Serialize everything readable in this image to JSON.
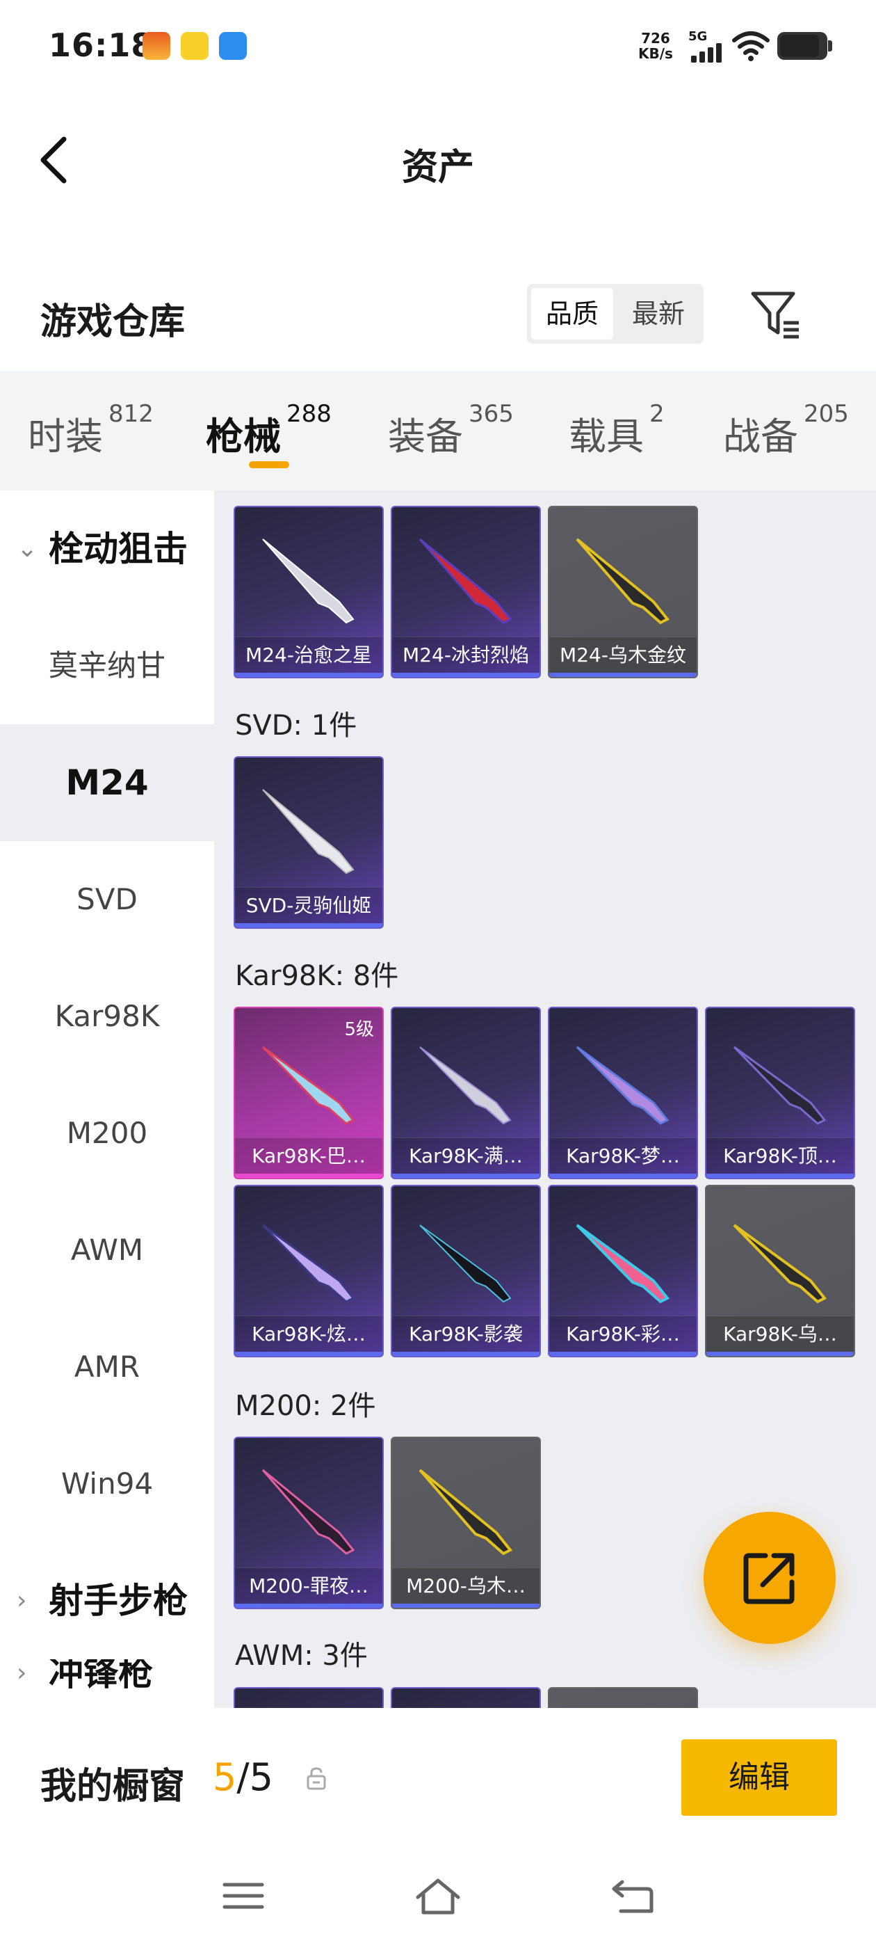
{
  "status_bar": {
    "time": "16:18",
    "net_speed_value": "726",
    "net_speed_unit": "KB/s",
    "network": "5G"
  },
  "header": {
    "title": "资产"
  },
  "warehouse": {
    "title": "游戏仓库",
    "sort_options": [
      "品质",
      "最新"
    ],
    "sort_selected": "品质"
  },
  "categories": [
    {
      "label": "时装",
      "count": "812"
    },
    {
      "label": "枪械",
      "count": "288"
    },
    {
      "label": "装备",
      "count": "365"
    },
    {
      "label": "载具",
      "count": "2"
    },
    {
      "label": "战备",
      "count": "205"
    }
  ],
  "sidebar": {
    "group1": "栓动狙击",
    "items": [
      "莫辛纳甘",
      "M24",
      "SVD",
      "Kar98K",
      "M200",
      "AWM",
      "AMR",
      "Win94"
    ],
    "group2": "射手步枪",
    "group3_partial": "冲锋枪"
  },
  "sections": [
    {
      "title": "",
      "items": [
        "M24-治愈之星",
        "M24-冰封烈焰",
        "M24-乌木金纹"
      ]
    },
    {
      "title": "SVD: 1件",
      "items": [
        "SVD-灵驹仙姬"
      ]
    },
    {
      "title": "Kar98K: 8件",
      "items": [
        "Kar98K-巴…",
        "Kar98K-满…",
        "Kar98K-梦…",
        "Kar98K-顶…",
        "Kar98K-炫…",
        "Kar98K-影袭",
        "Kar98K-彩…",
        "Kar98K-乌…"
      ],
      "level_badge": "5级"
    },
    {
      "title": "M200: 2件",
      "items": [
        "M200-罪夜…",
        "M200-乌木…"
      ]
    },
    {
      "title": "AWM: 3件",
      "items": []
    }
  ],
  "showcase": {
    "label": "我的橱窗",
    "current": "5",
    "separator": "/",
    "total": "5",
    "edit_label": "编辑"
  },
  "colors": {
    "accent": "#f7b800",
    "card_purple": "#3a3160",
    "card_gray": "#55565b",
    "card_pink": "#d13ec5"
  }
}
